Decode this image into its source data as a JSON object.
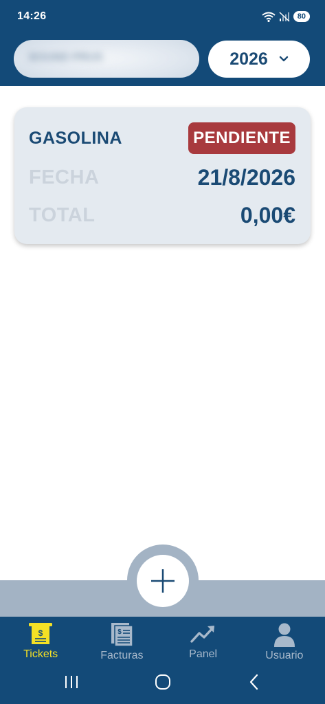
{
  "status_bar": {
    "time": "14:26",
    "battery": "80"
  },
  "header": {
    "company_name": "BOUND PRUS",
    "year": "2026"
  },
  "tickets": [
    {
      "concept": "GASOLINA",
      "status": "PENDIENTE",
      "date_label": "FECHA",
      "date": "21/8/2026",
      "total_label": "TOTAL",
      "total": "0,00€"
    }
  ],
  "bottom_nav": {
    "items": [
      {
        "label": "Tickets",
        "icon": "ticket-icon",
        "active": true
      },
      {
        "label": "Facturas",
        "icon": "invoice-icon",
        "active": false
      },
      {
        "label": "Panel",
        "icon": "trend-chart-icon",
        "active": false
      },
      {
        "label": "Usuario",
        "icon": "user-icon",
        "active": false
      }
    ]
  },
  "colors": {
    "primary": "#134a78",
    "text_primary": "#1a4a74",
    "status_pending": "#a83a3e",
    "nav_active": "#f4e025",
    "nav_inactive": "#a8b9cb",
    "card_bg": "#e4eaf0"
  }
}
